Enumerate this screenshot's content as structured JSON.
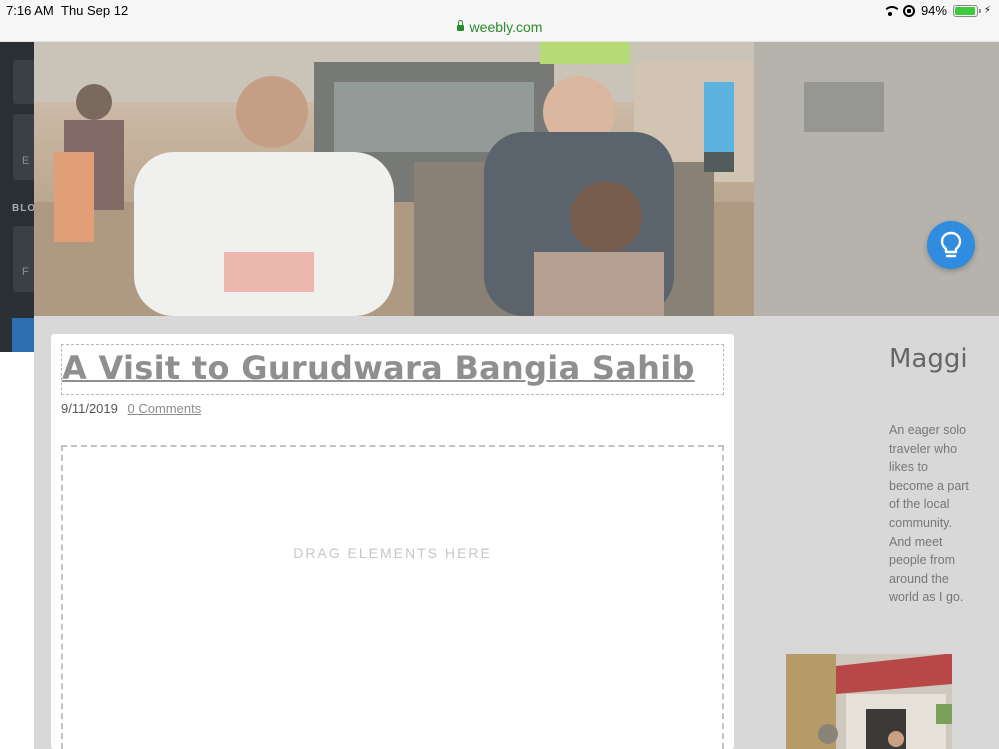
{
  "status_bar": {
    "time": "7:16 AM",
    "date": "Thu Sep 12",
    "url": "weebly.com",
    "battery": "94%",
    "battery_level": 0.94
  },
  "editor_panel": {
    "section_label": "BLO",
    "field_letter_1": "E",
    "field_letter_2": "F"
  },
  "post": {
    "title": "A Visit to Gurudwara Bangia Sahib",
    "date": "9/11/2019",
    "comments": "0 Comments",
    "drop_zone_label": "DRAG ELEMENTS HERE"
  },
  "sidebar": {
    "name": "Maggi",
    "bio": "An eager solo traveler who likes to become a part of the local community. And meet people from around the world as I go."
  },
  "colors": {
    "url_green": "#2e8a2e",
    "help_button_blue": "#2f8cdf",
    "editor_panel": "#2a2f33"
  },
  "icons": [
    "lock-icon",
    "wifi-icon",
    "orientation-lock-icon",
    "battery-icon",
    "charging-icon",
    "lightbulb-icon"
  ]
}
